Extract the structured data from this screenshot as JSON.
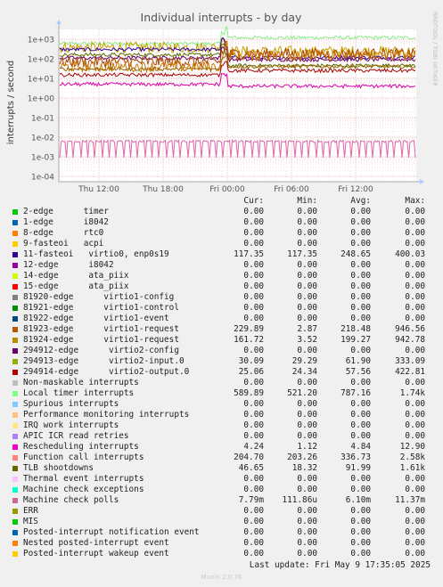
{
  "chart_data": {
    "type": "line",
    "title": "Individual interrupts - by day",
    "ylabel": "interrupts / second",
    "side_label": "RRDTOOL / TOBI OETIKER",
    "y_scale": "log",
    "ylim": [
      0.0001,
      1000
    ],
    "y_ticks": [
      "1e+03",
      "1e+02",
      "1e+01",
      "1e+00",
      "1e-01",
      "1e-02",
      "1e-03",
      "1e-04"
    ],
    "x_ticks": [
      "Thu 12:00",
      "Thu 18:00",
      "Fri 00:00",
      "Fri 06:00",
      "Fri 12:00"
    ],
    "grid": true,
    "series_plotted": [
      {
        "name": "Local timer interrupts",
        "color": "#88ee88",
        "before": 590,
        "after": 1200
      },
      {
        "name": "Function call interrupts",
        "color": "#c8a000",
        "before": 380,
        "after": 240
      },
      {
        "name": "11-fasteoi",
        "color": "#330099",
        "before": 300,
        "after": 117
      },
      {
        "name": "TLB shootdowns",
        "color": "#556b00",
        "before": 160,
        "after": 45
      },
      {
        "name": "294912-edge",
        "color": "#660066",
        "before": 110,
        "after": 90
      },
      {
        "name": "81923-edge",
        "color": "#aa4400",
        "before": 70,
        "after": 180
      },
      {
        "name": "81924-edge",
        "color": "#cc7700",
        "before": 40,
        "after": 150
      },
      {
        "name": "294913-edge",
        "color": "#996600",
        "before": 30,
        "after": 40
      },
      {
        "name": "294914-edge",
        "color": "#aa0000",
        "before": 15,
        "after": 25
      },
      {
        "name": "Rescheduling interrupts",
        "color": "#dd00aa",
        "before": 5,
        "after": 4
      },
      {
        "name": "Machine check polls",
        "color": "#dd66aa",
        "before": 0.006,
        "after": 0.006
      }
    ]
  },
  "legend": {
    "headers": {
      "cur": "Cur:",
      "min": "Min:",
      "avg": "Avg:",
      "max": "Max:"
    },
    "rows": [
      {
        "color": "#00cc00",
        "label": "2-edge      timer",
        "cur": "0.00",
        "min": "0.00",
        "avg": "0.00",
        "max": "0.00"
      },
      {
        "color": "#0066b3",
        "label": "1-edge      i8042",
        "cur": "0.00",
        "min": "0.00",
        "avg": "0.00",
        "max": "0.00"
      },
      {
        "color": "#ff8000",
        "label": "8-edge      rtc0",
        "cur": "0.00",
        "min": "0.00",
        "avg": "0.00",
        "max": "0.00"
      },
      {
        "color": "#ffcc00",
        "label": "9-fasteoi   acpi",
        "cur": "0.00",
        "min": "0.00",
        "avg": "0.00",
        "max": "0.00"
      },
      {
        "color": "#330099",
        "label": "11-fasteoi   virtio0, enp0s19",
        "cur": "117.35",
        "min": "117.35",
        "avg": "248.65",
        "max": "400.03"
      },
      {
        "color": "#990099",
        "label": "12-edge      i8042",
        "cur": "0.00",
        "min": "0.00",
        "avg": "0.00",
        "max": "0.00"
      },
      {
        "color": "#ccff00",
        "label": "14-edge      ata_piix",
        "cur": "0.00",
        "min": "0.00",
        "avg": "0.00",
        "max": "0.00"
      },
      {
        "color": "#ff0000",
        "label": "15-edge      ata_piix",
        "cur": "0.00",
        "min": "0.00",
        "avg": "0.00",
        "max": "0.00"
      },
      {
        "color": "#808080",
        "label": "81920-edge      virtio1-config",
        "cur": "0.00",
        "min": "0.00",
        "avg": "0.00",
        "max": "0.00"
      },
      {
        "color": "#008f00",
        "label": "81921-edge      virtio1-control",
        "cur": "0.00",
        "min": "0.00",
        "avg": "0.00",
        "max": "0.00"
      },
      {
        "color": "#00487d",
        "label": "81922-edge      virtio1-event",
        "cur": "0.00",
        "min": "0.00",
        "avg": "0.00",
        "max": "0.00"
      },
      {
        "color": "#b35a00",
        "label": "81923-edge      virtio1-request",
        "cur": "229.89",
        "min": "2.87",
        "avg": "218.48",
        "max": "946.56"
      },
      {
        "color": "#b38f00",
        "label": "81924-edge      virtio1-request",
        "cur": "161.72",
        "min": "3.52",
        "avg": "199.27",
        "max": "942.78"
      },
      {
        "color": "#6b006b",
        "label": "294912-edge      virtio2-config",
        "cur": "0.00",
        "min": "0.00",
        "avg": "0.00",
        "max": "0.00"
      },
      {
        "color": "#8fb300",
        "label": "294913-edge      virtio2-input.0",
        "cur": "30.09",
        "min": "29.29",
        "avg": "61.90",
        "max": "333.09"
      },
      {
        "color": "#b30000",
        "label": "294914-edge      virtio2-output.0",
        "cur": "25.06",
        "min": "24.34",
        "avg": "57.56",
        "max": "422.81"
      },
      {
        "color": "#bebebe",
        "label": "Non-maskable interrupts",
        "cur": "0.00",
        "min": "0.00",
        "avg": "0.00",
        "max": "0.00"
      },
      {
        "color": "#80ff80",
        "label": "Local timer interrupts",
        "cur": "589.89",
        "min": "521.20",
        "avg": "787.16",
        "max": "1.74k"
      },
      {
        "color": "#80c9ff",
        "label": "Spurious interrupts",
        "cur": "0.00",
        "min": "0.00",
        "avg": "0.00",
        "max": "0.00"
      },
      {
        "color": "#ffc080",
        "label": "Performance monitoring interrupts",
        "cur": "0.00",
        "min": "0.00",
        "avg": "0.00",
        "max": "0.00"
      },
      {
        "color": "#ffe680",
        "label": "IRQ work interrupts",
        "cur": "0.00",
        "min": "0.00",
        "avg": "0.00",
        "max": "0.00"
      },
      {
        "color": "#aa80ff",
        "label": "APIC ICR read retries",
        "cur": "0.00",
        "min": "0.00",
        "avg": "0.00",
        "max": "0.00"
      },
      {
        "color": "#ee00cc",
        "label": "Rescheduling interrupts",
        "cur": "4.24",
        "min": "1.12",
        "avg": "4.84",
        "max": "12.90"
      },
      {
        "color": "#ff8080",
        "label": "Function call interrupts",
        "cur": "204.70",
        "min": "203.26",
        "avg": "336.73",
        "max": "2.58k"
      },
      {
        "color": "#666600",
        "label": "TLB shootdowns",
        "cur": "46.65",
        "min": "18.32",
        "avg": "91.99",
        "max": "1.61k"
      },
      {
        "color": "#ffbfff",
        "label": "Thermal event interrupts",
        "cur": "0.00",
        "min": "0.00",
        "avg": "0.00",
        "max": "0.00"
      },
      {
        "color": "#00ffcc",
        "label": "Machine check exceptions",
        "cur": "0.00",
        "min": "0.00",
        "avg": "0.00",
        "max": "0.00"
      },
      {
        "color": "#cc6699",
        "label": "Machine check polls",
        "cur": "7.79m",
        "min": "111.86u",
        "avg": "6.10m",
        "max": "11.37m"
      },
      {
        "color": "#999900",
        "label": "ERR",
        "cur": "0.00",
        "min": "0.00",
        "avg": "0.00",
        "max": "0.00"
      },
      {
        "color": "#00cc00",
        "label": "MIS",
        "cur": "0.00",
        "min": "0.00",
        "avg": "0.00",
        "max": "0.00"
      },
      {
        "color": "#0066b3",
        "label": "Posted-interrupt notification event",
        "cur": "0.00",
        "min": "0.00",
        "avg": "0.00",
        "max": "0.00"
      },
      {
        "color": "#ff8000",
        "label": "Nested posted-interrupt event",
        "cur": "0.00",
        "min": "0.00",
        "avg": "0.00",
        "max": "0.00"
      },
      {
        "color": "#ffcc00",
        "label": "Posted-interrupt wakeup event",
        "cur": "0.00",
        "min": "0.00",
        "avg": "0.00",
        "max": "0.00"
      }
    ]
  },
  "footer": {
    "last_update": "Last update: Fri May  9 17:35:05 2025",
    "munin": "Munin 2.0.76"
  }
}
